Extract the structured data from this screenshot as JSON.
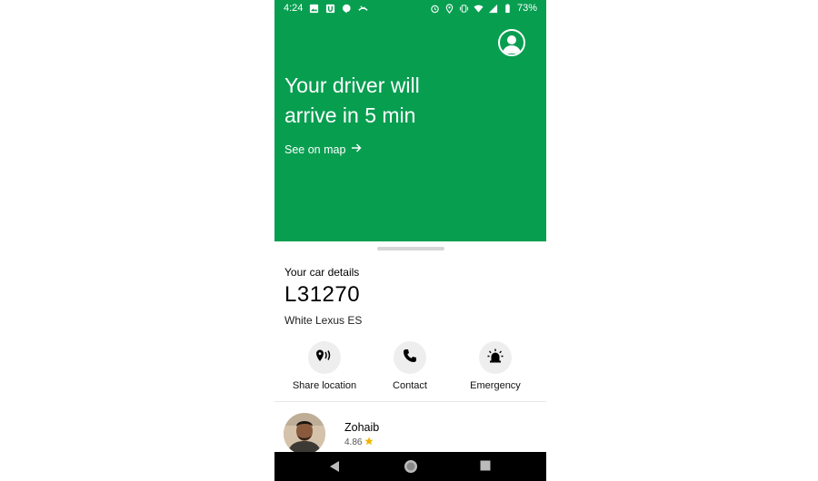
{
  "status_bar": {
    "time": "4:24",
    "battery": "73%",
    "left_icons": [
      "image-icon",
      "u-app-icon",
      "hangouts-icon",
      "missed-call-icon"
    ],
    "right_icons": [
      "alarm-icon",
      "location-icon",
      "vibrate-icon",
      "wifi-icon",
      "signal-icon",
      "battery-icon"
    ]
  },
  "hero": {
    "headline_line1": "Your driver will",
    "headline_line2": "arrive in 5 min",
    "see_on_map": "See on map",
    "background": "#079e50"
  },
  "car": {
    "section_title": "Your car details",
    "plate": "L31270",
    "model": "White Lexus ES"
  },
  "actions": [
    {
      "label": "Share location",
      "icon": "share-location-icon"
    },
    {
      "label": "Contact",
      "icon": "phone-icon"
    },
    {
      "label": "Emergency",
      "icon": "siren-icon"
    }
  ],
  "driver": {
    "name": "Zohaib",
    "rating": "4.86",
    "rating_icon": "star-icon",
    "star_color": "#f0b400"
  },
  "nav": [
    "back-icon",
    "home-icon",
    "recents-icon"
  ]
}
